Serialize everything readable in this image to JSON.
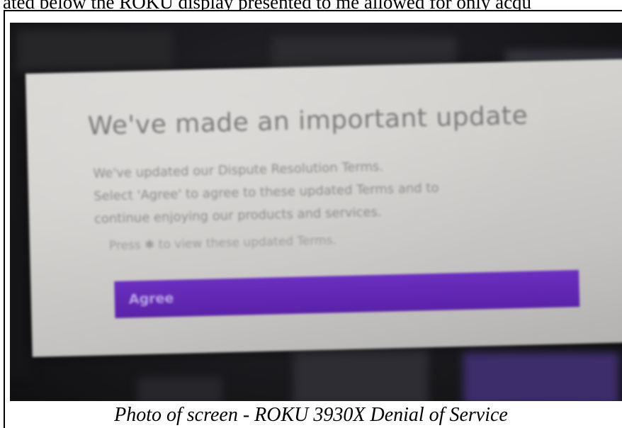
{
  "document": {
    "top_text": "ated below the ROKU display presented to me allowed for only acqu",
    "caption": "Photo of screen - ROKU 3930X Denial of Service"
  },
  "dialog": {
    "title": "We've made an important update",
    "body_lines": [
      "We've updated our Dispute Resolution Terms.",
      "Select 'Agree' to agree to these updated Terms and to",
      "continue enjoying our products and services."
    ],
    "hint": "Press ✱ to view these updated Terms.",
    "agree_label": "Agree"
  },
  "colors": {
    "agree_button": "#5a22a8",
    "dialog_background": "#d3d1ce",
    "screen_background": "#1b1b1f"
  }
}
